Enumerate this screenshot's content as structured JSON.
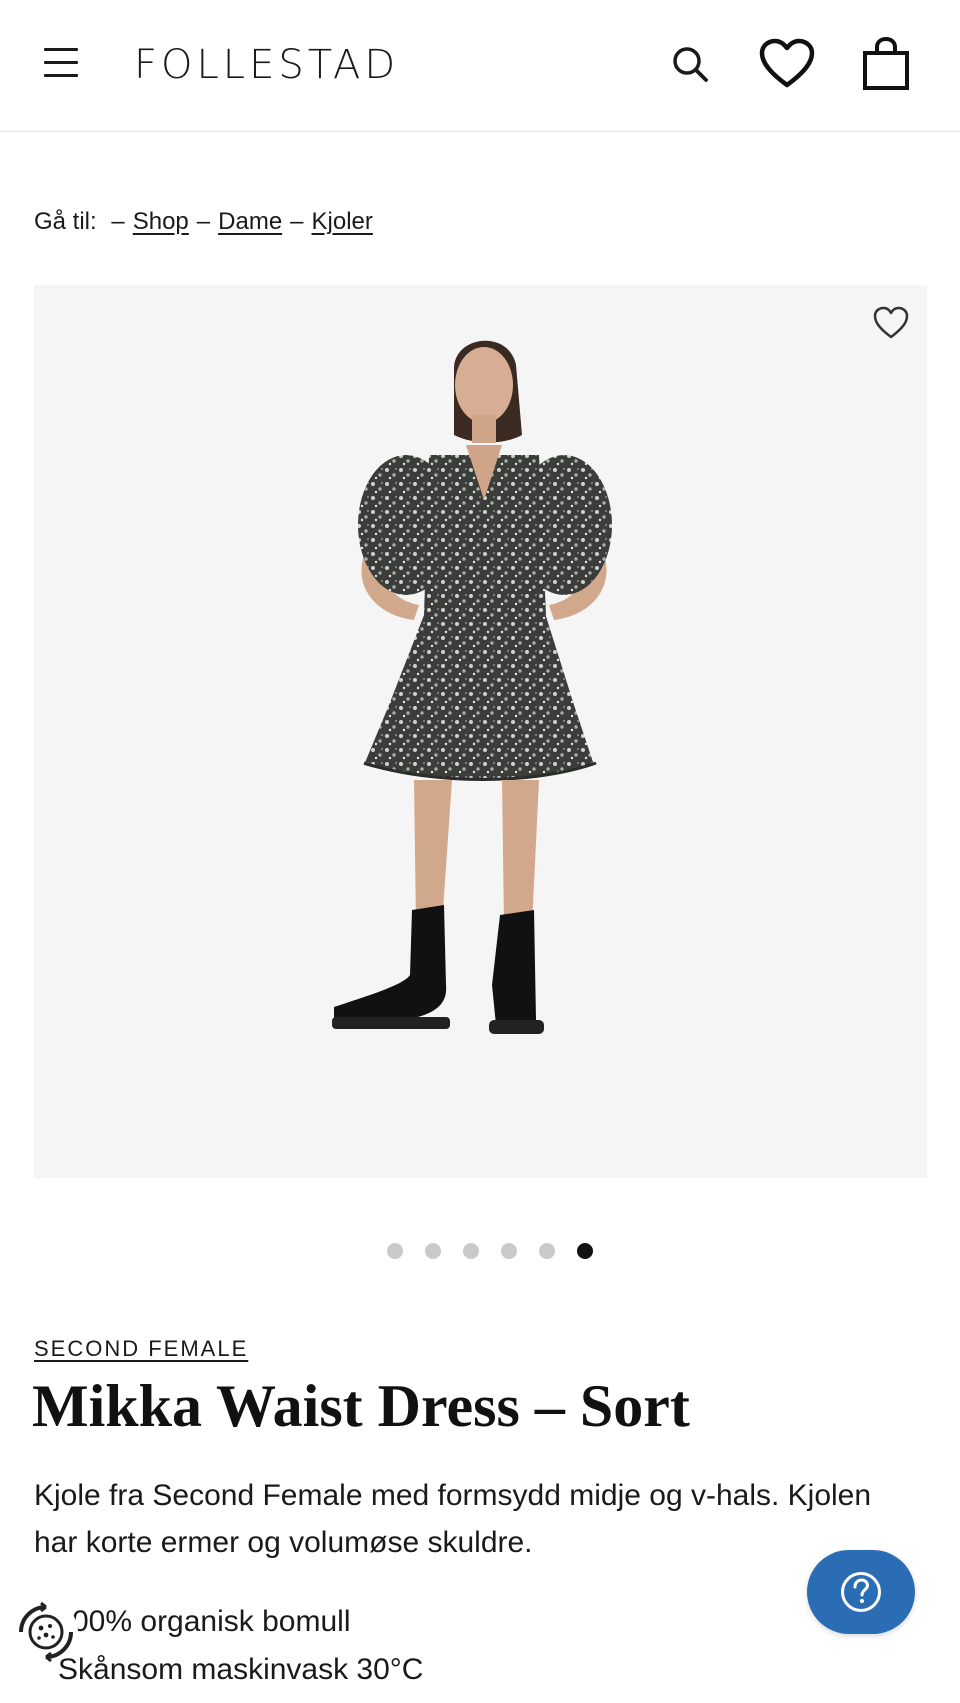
{
  "header": {
    "logo": "FOLLESTAD",
    "menu_icon": "hamburger-menu-icon",
    "search_icon": "search-icon",
    "wishlist_icon": "heart-icon",
    "cart_icon": "shopping-bag-icon"
  },
  "breadcrumb": {
    "prefix": "Gå til:",
    "separator": "–",
    "items": [
      "Shop",
      "Dame",
      "Kjoler"
    ]
  },
  "gallery": {
    "favorite_icon": "heart-outline-icon",
    "image": "product-photo-woman-in-floral-dress-and-black-boots",
    "dot_count": 6,
    "active_dot": 6
  },
  "product": {
    "brand": "SECOND FEMALE",
    "title": "Mikka Waist Dress – Sort",
    "description": "Kjole fra Second Female med formsydd midje og v-hals. Kjolen har korte ermer og volumøse skuldre.",
    "bullets": [
      "00% organisk bomull",
      "Skånsom maskinvask 30°C"
    ]
  },
  "widgets": {
    "help_icon": "question-mark-icon",
    "cookie_icon": "cookie-settings-icon"
  },
  "colors": {
    "text": "#1a1a1a",
    "image_bg": "#f5f5f5",
    "help_button": "#2b6db5",
    "dot_inactive": "#c9c9c9",
    "dot_active": "#111111"
  }
}
